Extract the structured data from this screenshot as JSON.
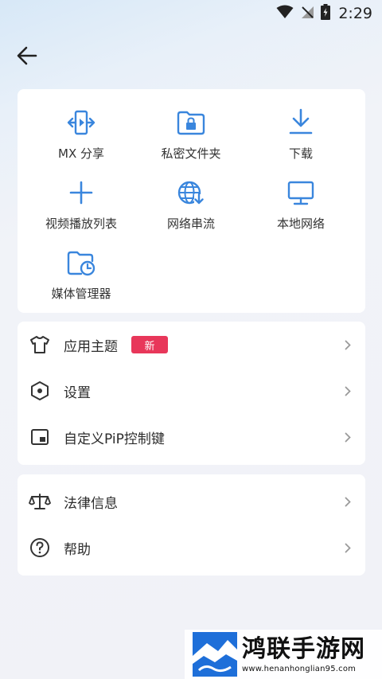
{
  "status_bar": {
    "time": "2:29"
  },
  "colors": {
    "accent": "#3a86dd",
    "badge": "#e8375a",
    "icon_dark": "#333333",
    "chevron": "#9a9a9a"
  },
  "grid": {
    "items": [
      {
        "label": "MX 分享",
        "icon": "mx-share-icon"
      },
      {
        "label": "私密文件夹",
        "icon": "private-folder-icon"
      },
      {
        "label": "下载",
        "icon": "download-icon"
      },
      {
        "label": "视频播放列表",
        "icon": "add-playlist-icon"
      },
      {
        "label": "网络串流",
        "icon": "network-stream-icon"
      },
      {
        "label": "本地网络",
        "icon": "local-network-icon"
      },
      {
        "label": "媒体管理器",
        "icon": "media-manager-icon"
      }
    ]
  },
  "settings_list": {
    "items": [
      {
        "label": "应用主题",
        "icon": "shirt-icon",
        "badge": "新"
      },
      {
        "label": "设置",
        "icon": "settings-hexagon-icon"
      },
      {
        "label": "自定义PiP控制键",
        "icon": "pip-icon"
      }
    ]
  },
  "info_list": {
    "items": [
      {
        "label": "法律信息",
        "icon": "scales-icon"
      },
      {
        "label": "帮助",
        "icon": "help-icon"
      }
    ]
  },
  "watermark": {
    "title": "鸿联手游网",
    "url": "www.henanhonglian95.com"
  }
}
